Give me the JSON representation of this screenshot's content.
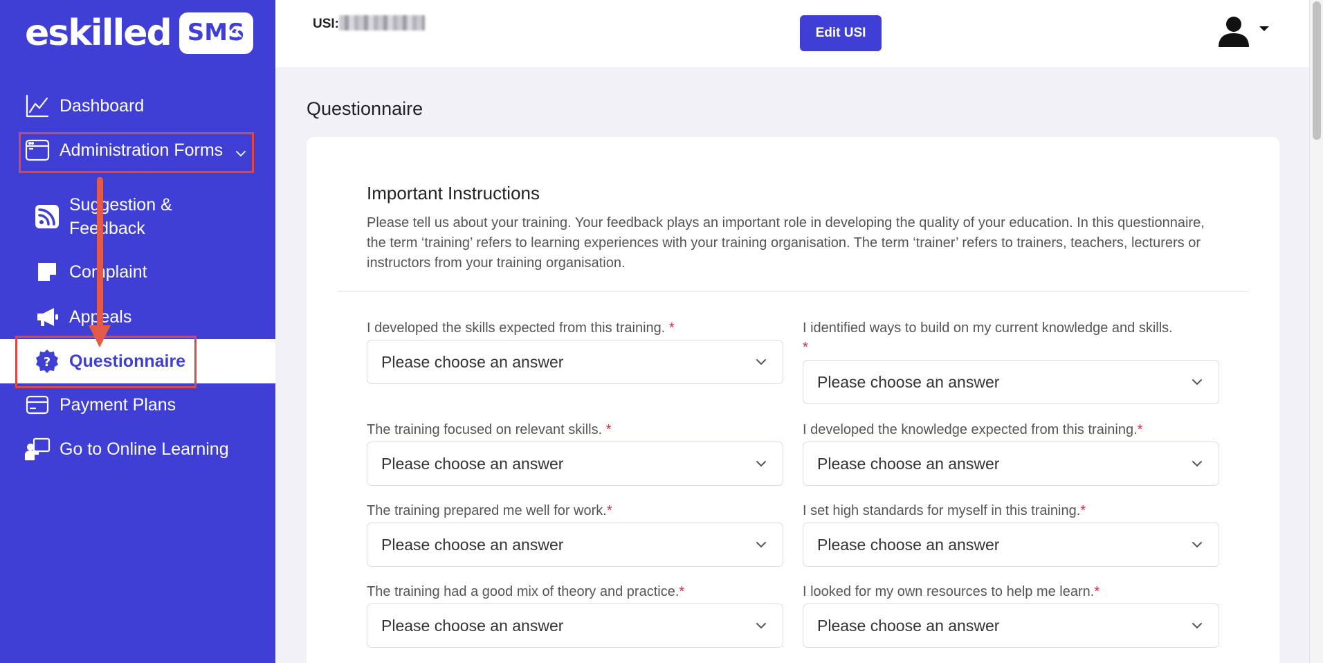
{
  "brand": {
    "word": "eskilled",
    "badge": "SMS",
    "collapse_icon": "«"
  },
  "sidebar": {
    "items": [
      {
        "label": "Dashboard",
        "icon": "chart-line-icon"
      },
      {
        "label": "Administration Forms",
        "icon": "window-icon"
      },
      {
        "label": "Suggestion & Feedback",
        "icon": "rss-icon"
      },
      {
        "label": "Complaint",
        "icon": "note-icon"
      },
      {
        "label": "Appeals",
        "icon": "megaphone-icon"
      },
      {
        "label": "Questionnaire",
        "icon": "question-badge-icon",
        "active": true
      },
      {
        "label": "Payment Plans",
        "icon": "credit-card-icon"
      },
      {
        "label": "Go to Online Learning",
        "icon": "presenter-icon"
      }
    ]
  },
  "header": {
    "usi_label": "USI:",
    "edit_usi": "Edit USI"
  },
  "colors": {
    "brand": "#3f3fd6",
    "highlight": "#e04646",
    "required": "#e0283c",
    "background": "#f1f1f7"
  },
  "main": {
    "title": "Questionnaire",
    "section_title": "Important Instructions",
    "section_desc": "Please tell us about your training. Your feedback plays an important role in developing the quality of your education. In this questionnaire, the term ‘training’ refers to learning experiences with your training organisation. The term ‘trainer’ refers to trainers, teachers, lecturers or instructors from your training organisation.",
    "required_mark": "*",
    "placeholder": "Please choose an answer",
    "questions": [
      {
        "text": "I developed the skills expected from this training."
      },
      {
        "text": "I identified ways to build on my current knowledge and skills."
      },
      {
        "text": "The training focused on relevant skills."
      },
      {
        "text": "I developed the knowledge expected from this training."
      },
      {
        "text": "The training prepared me well for work."
      },
      {
        "text": "I set high standards for myself in this training."
      },
      {
        "text": "The training had a good mix of theory and practice."
      },
      {
        "text": "I looked for my own resources to help me learn."
      }
    ]
  }
}
